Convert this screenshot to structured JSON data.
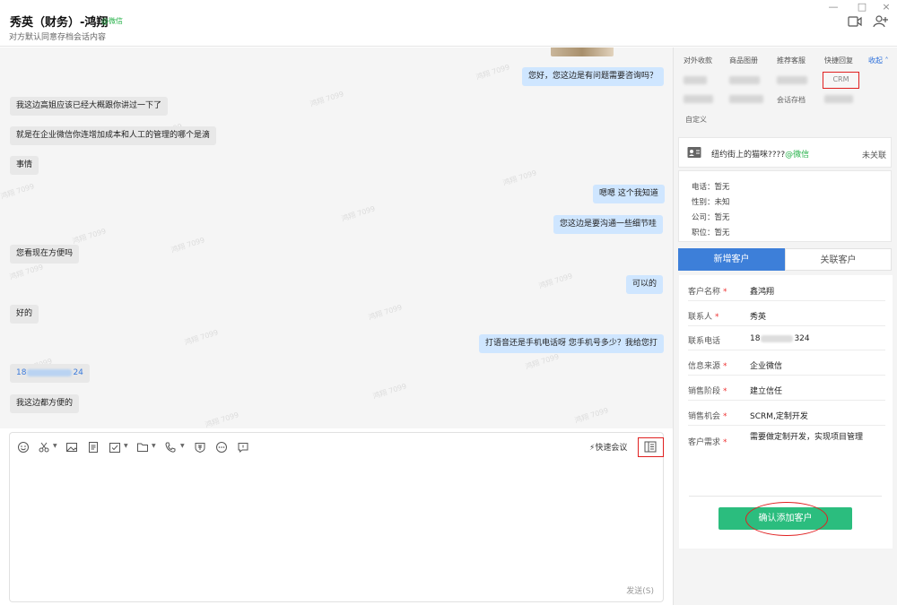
{
  "header": {
    "title": "秀英（财务）-鸿翔",
    "wechat_tag": "@微信",
    "subtitle": "对方默认同意存档会话内容"
  },
  "window_controls": {
    "minimize": "—",
    "maximize": "□",
    "close": "×"
  },
  "chat": {
    "watermark": "鸿翔 7099",
    "messages": [
      {
        "dir": "out",
        "text": "您好，您这边是有问题需要咨询吗？"
      },
      {
        "dir": "in",
        "text": "我这边高姐应该已经大概跟你讲过一下了"
      },
      {
        "dir": "in",
        "text": "就是在企业微信你连增加成本和人工的管理的哪个是滴"
      },
      {
        "dir": "in",
        "text": "事情"
      },
      {
        "dir": "out",
        "text": "嗯嗯 这个我知道"
      },
      {
        "dir": "out",
        "text": "您这边是要沟通一些细节哇"
      },
      {
        "dir": "in",
        "text": "您看现在方便吗"
      },
      {
        "dir": "out",
        "text": "可以的"
      },
      {
        "dir": "in",
        "text": "好的"
      },
      {
        "dir": "out",
        "text": "打语音还是手机电话呀 您手机号多少？我给您打"
      },
      {
        "dir": "in",
        "text_prefix": "18",
        "text_suffix": "24"
      },
      {
        "dir": "in",
        "text": "我这边都方便的"
      }
    ]
  },
  "composer": {
    "toolbar_icons": [
      "emoji-icon",
      "scissors-icon",
      "image-icon",
      "file-icon",
      "task-icon",
      "folder-icon",
      "phone-icon",
      "coupon-icon",
      "more-icon",
      "message-icon"
    ],
    "quick_meeting": "快速会议",
    "send": "发送(S)"
  },
  "right_panel": {
    "tabs": [
      "对外收款",
      "商品图册",
      "推荐客服",
      "快捷回复"
    ],
    "collapse": "收起",
    "crm": "CRM",
    "archive": "会话存档",
    "custom": "自定义",
    "linked_user": {
      "name": "纽约街上的猫咪????",
      "channel": "@微信",
      "status": "未关联"
    },
    "info": [
      {
        "label": "电话：",
        "value": "暂无"
      },
      {
        "label": "性别：",
        "value": "未知"
      },
      {
        "label": "公司：",
        "value": "暂无"
      },
      {
        "label": "职位：",
        "value": "暂无"
      }
    ],
    "segments": {
      "new": "新增客户",
      "link": "关联客户"
    },
    "form": [
      {
        "label": "客户名称",
        "required": true,
        "value": "鑫鸿翔"
      },
      {
        "label": "联系人",
        "required": true,
        "value": "秀英"
      },
      {
        "label": "联系电话",
        "required": false,
        "value_prefix": "18",
        "value_suffix": "324"
      },
      {
        "label": "信息来源",
        "required": true,
        "value": "企业微信"
      },
      {
        "label": "销售阶段",
        "required": true,
        "value": "建立信任"
      },
      {
        "label": "销售机会",
        "required": true,
        "value": "SCRM,定制开发"
      },
      {
        "label": "客户需求",
        "required": true,
        "value": "需要做定制开发，实现项目管理"
      }
    ],
    "confirm": "确认添加客户"
  }
}
